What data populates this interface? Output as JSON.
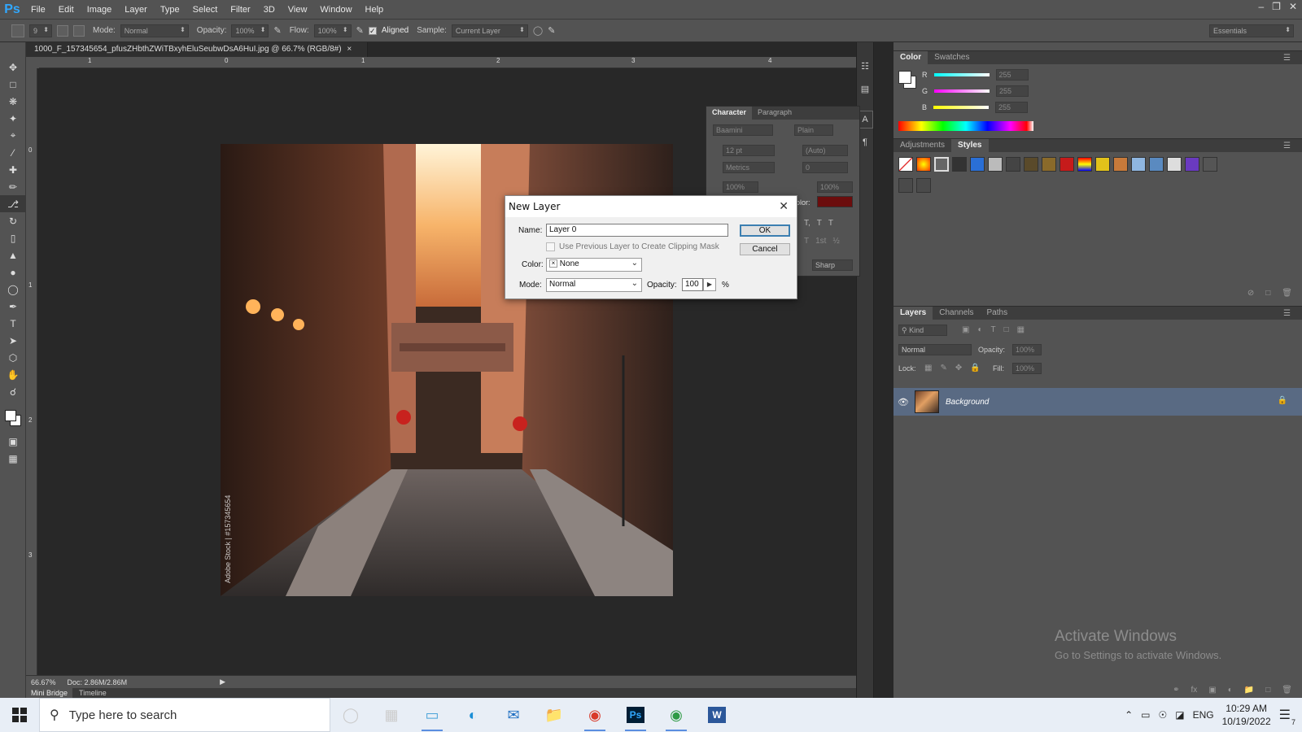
{
  "app": {
    "logo": "Ps"
  },
  "menu": [
    "File",
    "Edit",
    "Image",
    "Layer",
    "Type",
    "Select",
    "Filter",
    "3D",
    "View",
    "Window",
    "Help"
  ],
  "options": {
    "brush_size": "9",
    "mode_label": "Mode:",
    "mode_value": "Normal",
    "opacity_label": "Opacity:",
    "opacity_value": "100%",
    "flow_label": "Flow:",
    "flow_value": "100%",
    "aligned_label": "Aligned",
    "sample_label": "Sample:",
    "sample_value": "Current Layer",
    "workspace": "Essentials"
  },
  "document": {
    "tab_title": "1000_F_157345654_pfusZHbthZWiTBxyhEluSeubwDsA6HuI.jpg @ 66.7% (RGB/8#)",
    "ruler_h": [
      "1",
      "0",
      "1",
      "2",
      "3",
      "4"
    ],
    "ruler_v": [
      "0",
      "1",
      "2",
      "3"
    ],
    "watermark": "Adobe Stock | #157345654",
    "zoom": "66.67%",
    "doc_size": "Doc: 2.86M/2.86M"
  },
  "bottom_tabs": [
    "Mini Bridge",
    "Timeline"
  ],
  "character": {
    "tabs": [
      "Character",
      "Paragraph"
    ],
    "font_family": "Baamini",
    "font_style": "Plain",
    "size": "12 pt",
    "leading": "(Auto)",
    "kerning": "Metrics",
    "tracking": "0",
    "vscale": "100%",
    "hscale": "100%",
    "color_label": "olor:",
    "antialias": "Sharp",
    "style_btns": [
      "T,",
      "T",
      "T",
      "T",
      "1st",
      "½"
    ]
  },
  "color_panel": {
    "tabs": [
      "Color",
      "Swatches"
    ],
    "channels": [
      {
        "label": "R",
        "value": "255"
      },
      {
        "label": "G",
        "value": "255"
      },
      {
        "label": "B",
        "value": "255"
      }
    ]
  },
  "adjustments": {
    "tabs": [
      "Adjustments",
      "Styles"
    ]
  },
  "layers": {
    "tabs": [
      "Layers",
      "Channels",
      "Paths"
    ],
    "kind": "Kind",
    "blend": "Normal",
    "opacity_label": "Opacity:",
    "opacity_value": "100%",
    "lock_label": "Lock:",
    "fill_label": "Fill:",
    "fill_value": "100%",
    "items": [
      {
        "name": "Background"
      }
    ]
  },
  "dialog": {
    "title": "New Layer",
    "name_label": "Name:",
    "name_value": "Layer 0",
    "clip_label": "Use Previous Layer to Create Clipping Mask",
    "color_label": "Color:",
    "color_value": "None",
    "mode_label": "Mode:",
    "mode_value": "Normal",
    "opacity_label": "Opacity:",
    "opacity_value": "100",
    "percent": "%",
    "ok": "OK",
    "cancel": "Cancel"
  },
  "activate": {
    "line1": "Activate Windows",
    "line2": "Go to Settings to activate Windows."
  },
  "taskbar": {
    "search_placeholder": "Type here to search",
    "lang": "ENG",
    "time": "10:29 AM",
    "date": "10/19/2022",
    "notif_count": "7"
  }
}
